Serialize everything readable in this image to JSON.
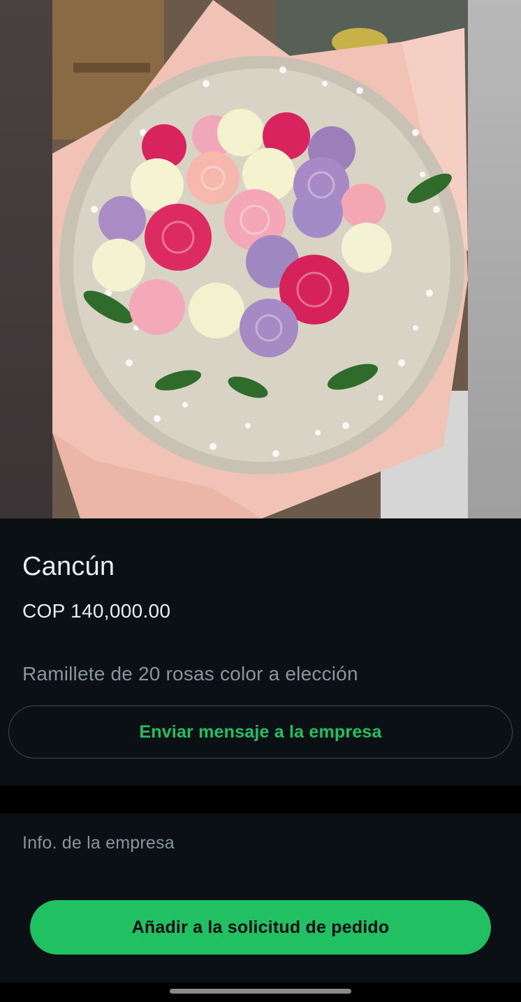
{
  "product": {
    "title": "Cancún",
    "price": "COP 140,000.00",
    "description": "Ramillete de 20 rosas color a elección"
  },
  "actions": {
    "message_label": "Enviar mensaje a la empresa",
    "add_to_order_label": "Añadir a la solicitud de pedido"
  },
  "company": {
    "info_label": "Info. de la empresa"
  },
  "colors": {
    "accent": "#21c063",
    "background": "#0b1014",
    "primary_text": "#e9edef",
    "secondary_text": "#8696a0"
  }
}
